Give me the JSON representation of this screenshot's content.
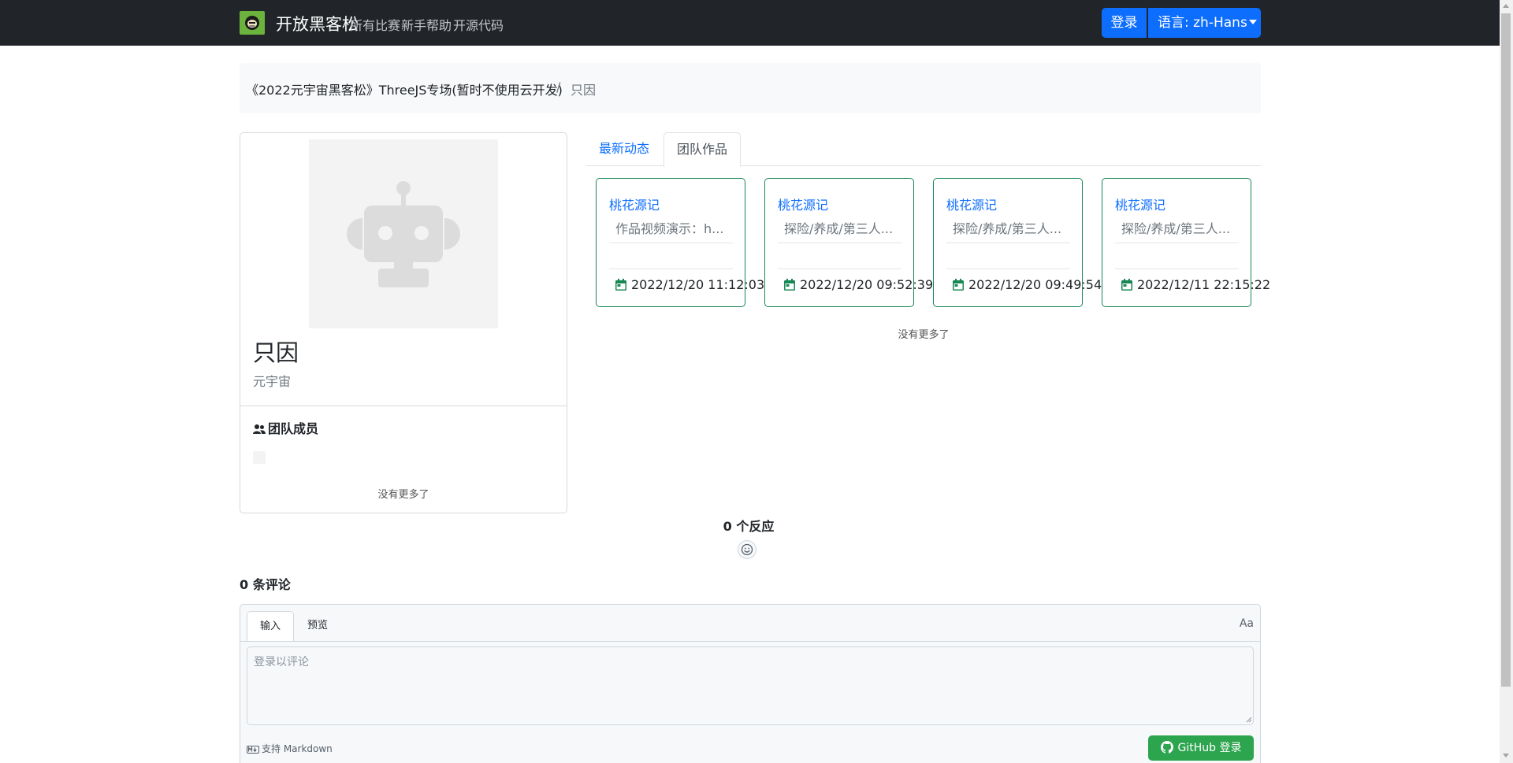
{
  "navbar": {
    "brand": "开放黑客松",
    "links": [
      "所有比赛",
      "新手帮助",
      "开源代码"
    ],
    "login_label": "登录",
    "language_label": "语言: zh-Hans"
  },
  "breadcrumb": {
    "parent": "《2022元宇宙黑客松》ThreeJS专场(暂时不使用云开发)",
    "separator": "/",
    "current": "只因"
  },
  "team": {
    "name": "只因",
    "subtitle": "元宇宙",
    "members_heading": "团队成员",
    "no_more": "没有更多了"
  },
  "tabs": {
    "latest": "最新动态",
    "works": "团队作品"
  },
  "works": [
    {
      "title": "桃花源记",
      "description": "作品视频演示：h...",
      "date": "2022/12/20 11:12:03"
    },
    {
      "title": "桃花源记",
      "description": "探险/养成/第三人...",
      "date": "2022/12/20 09:52:39"
    },
    {
      "title": "桃花源记",
      "description": "探险/养成/第三人...",
      "date": "2022/12/20 09:49:54"
    },
    {
      "title": "桃花源记",
      "description": "探险/养成/第三人...",
      "date": "2022/12/11 22:15:22"
    }
  ],
  "works_no_more": "没有更多了",
  "reactions": {
    "count_label": "0 个反应"
  },
  "comments": {
    "count_label": "0 条评论",
    "tab_input": "输入",
    "tab_preview": "预览",
    "font_toggle": "Aa",
    "placeholder": "登录以评论",
    "markdown_hint": "支持 Markdown",
    "github_login": "GitHub 登录"
  },
  "colors": {
    "navbar_bg": "#212529",
    "primary": "#0d6efd",
    "success": "#198754",
    "github_green": "#2da44e"
  },
  "icons": {
    "brand": "brand-logo-icon",
    "members": "people-icon",
    "date": "calendar-icon",
    "reaction": "smiley-icon",
    "markdown": "markdown-icon",
    "github": "github-icon"
  }
}
